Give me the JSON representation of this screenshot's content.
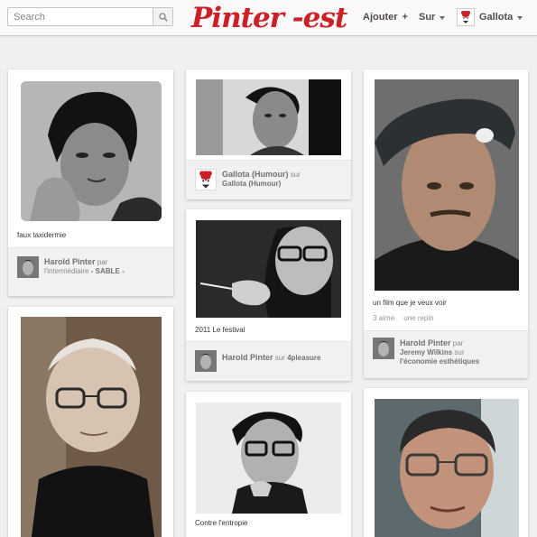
{
  "header": {
    "search_placeholder": "Search",
    "logo_text": "Pinter -est",
    "nav": {
      "add_label": "Ajouter",
      "add_symbol": "+",
      "about_label": "Sur",
      "user_name": "Gallota"
    }
  },
  "pins": [
    {
      "description": "faux taxidermie",
      "pinner": "Harold Pinter",
      "by": "par",
      "line2": "l'intermédiaire",
      "board": "- SABLE -"
    },
    {
      "pinner": "Gallota (Humour)",
      "by": "sur",
      "board": "Gallota (Humour)"
    },
    {
      "description": "un film que je veux voir",
      "likes": "3 aime",
      "repins": "une repin",
      "pinner": "Harold Pinter",
      "by": "par",
      "via_user": "Jeremy Wilkins",
      "via_word": "sur",
      "board": "l'économie esthétiques"
    },
    {
      "description": "2011 Le festival",
      "pinner": "Harold Pinter",
      "by": "sur",
      "board": "4pleasure"
    },
    {
      "description": "Contre l'entropie"
    }
  ],
  "colors": {
    "brand_red": "#cb2027",
    "page_bg": "#f1f0f0",
    "footer_bg": "#f2f0f0",
    "text_muted": "#8c8888"
  },
  "icons": {
    "search": "magnifier-icon",
    "avatar": "gallota-bird-icon"
  }
}
